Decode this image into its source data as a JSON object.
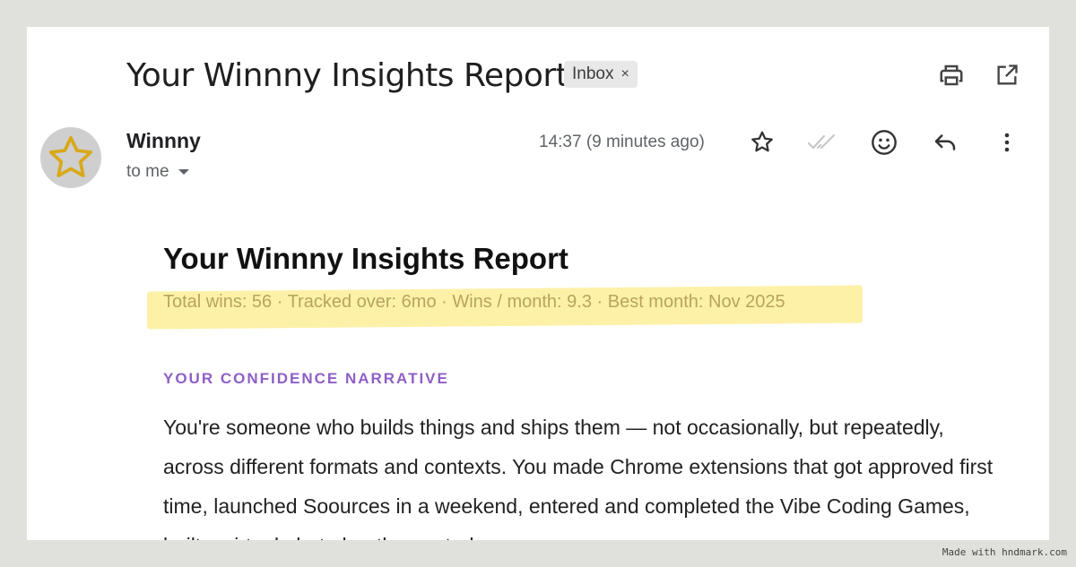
{
  "email": {
    "subject": "Your Winnny Insights Report",
    "label": "Inbox",
    "label_remove": "×",
    "sender_name": "Winnny",
    "recipient": "to me",
    "timestamp": "14:37 (9 minutes ago)"
  },
  "body": {
    "title": "Your Winnny Insights Report",
    "stats": "Total wins: 56 · Tracked over: 6mo · Wins / month: 9.3 · Best month: Nov 2025",
    "section_heading": "YOUR CONFIDENCE NARRATIVE",
    "paragraph": "You're someone who builds things and ships them — not occasionally, but repeatedly, across different formats and contexts. You made Chrome extensions that got approved first time, launched Soources in a weekend, entered and completed the Vibe Coding Games, built a virtual photo booth, created"
  },
  "icons": {
    "print": "print-icon",
    "open_new": "open-in-new-icon",
    "avatar": "star-icon",
    "star": "star-outline-icon",
    "read": "double-check-icon",
    "emoji": "emoji-icon",
    "reply": "reply-icon",
    "more": "more-vert-icon"
  },
  "colors": {
    "page_bg": "#e0e0dc",
    "avatar_star": "#d9a81a",
    "highlight": "#fdf1a8",
    "stats_text": "#b8a45c",
    "section_heading": "#8e5fc6"
  },
  "watermark": "Made with hndmark.com"
}
